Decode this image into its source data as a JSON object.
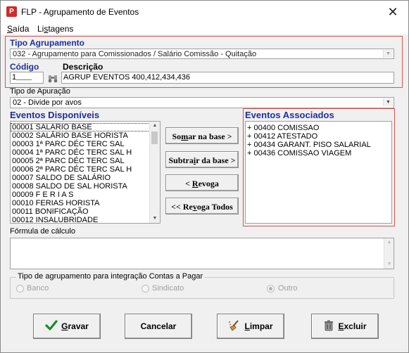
{
  "window": {
    "title": "FLP - Agrupamento de Eventos",
    "app_icon": "P"
  },
  "menu": {
    "items": [
      {
        "first": "S",
        "rest": "aída"
      },
      {
        "first": "Li",
        "underline": "s",
        "rest": "tagens"
      }
    ]
  },
  "tipo_agrupamento": {
    "label": "Tipo Agrupamento",
    "value": "032 - Agrupamento para Comissionados / Salário Comissão - Quitação"
  },
  "codigo": {
    "label": "Código",
    "value": "1",
    "search_icon": "binoculars-icon"
  },
  "descricao": {
    "label": "Descrição",
    "value": "AGRUP EVENTOS 400,412,434,436"
  },
  "tipo_apuracao": {
    "label": "Tipo de Apuração",
    "value": "02 - Divide por avos"
  },
  "eventos_disponiveis": {
    "label": "Eventos Disponíveis",
    "items": [
      "00001 SALARIO BASE",
      "00002 SALÁRIO BASE HORISTA",
      "00003 1ª PARC DÉC TERC SAL",
      "00004 1ª PARC DÉC TERC SAL H",
      "00005 2ª PARC DÉC TERC SAL",
      "00006 2ª PARC DÉC TERC SAL H",
      "00007 SALDO DE SALÁRIO",
      "00008 SALDO DE SAL HORISTA",
      "00009 F E R I A S",
      "00010 FERIAS HORISTA",
      "00011 BONIFICAÇÃO",
      "00012 INSALUBRIDADE"
    ]
  },
  "buttons_mid": {
    "somar": {
      "pre": "So",
      "ul": "m",
      "post": "ar  na base >"
    },
    "subtrair": {
      "pre": "Subtra",
      "ul": "i",
      "post": "r da base >"
    },
    "revoga": {
      "pre": "< ",
      "ul": "R",
      "post": "evoga"
    },
    "revoga_todos": {
      "pre": "<< Re",
      "ul": "v",
      "post": "oga Todos"
    }
  },
  "eventos_associados": {
    "label": "Eventos Associados",
    "items": [
      "+ 00400 COMISSAO",
      "+ 00412 ATESTADO",
      "+ 00434 GARANT. PISO SALARIAL",
      "+ 00436 COMISSAO  VIAGEM"
    ]
  },
  "formula": {
    "label": "Fórmula de cálculo",
    "value": ""
  },
  "integracao": {
    "label": "Tipo de agrupamento para integração Contas a Pagar",
    "options": [
      {
        "label": "Banco",
        "checked": false
      },
      {
        "label": "Sindicato",
        "checked": false
      },
      {
        "label": "Outro",
        "checked": true
      }
    ]
  },
  "footer": {
    "gravar": {
      "ul": "G",
      "post": "ravar",
      "icon": "checkmark-icon"
    },
    "cancelar": {
      "label": "Cancelar"
    },
    "limpar": {
      "ul": "L",
      "post": "impar",
      "icon": "broom-icon"
    },
    "excluir": {
      "ul": "E",
      "post": "xcluir",
      "icon": "trash-icon"
    }
  },
  "colors": {
    "section_label": "#1f2f9e",
    "highlight_border": "#d9534f",
    "gravar_check": "#1e8a2a"
  }
}
